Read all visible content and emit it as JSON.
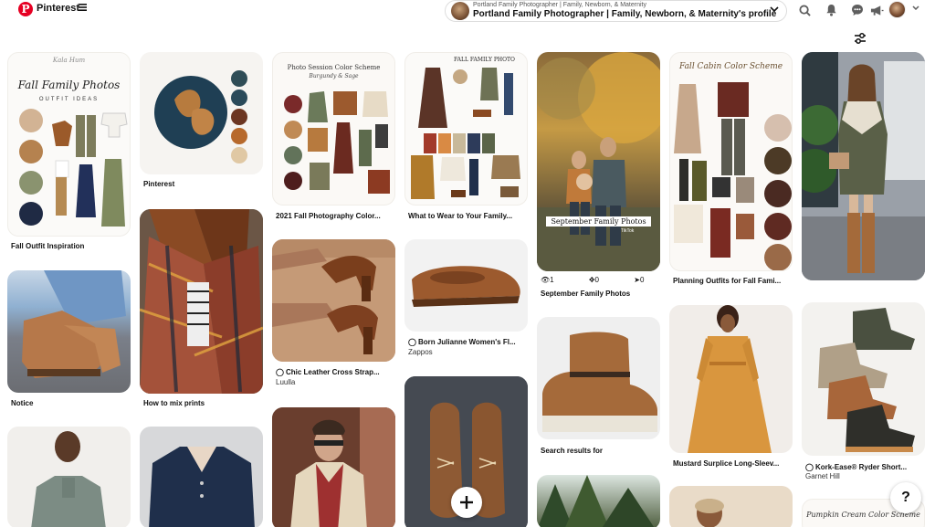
{
  "header": {
    "brand": "Pinterest",
    "profile_small": "Portland Family Photographer | Family, Newborn, & Maternity",
    "profile_main": "Portland Family Photographer | Family, Newborn, & Maternity's profile",
    "icons": [
      "search-icon",
      "bell-icon",
      "messages-icon",
      "megaphone-icon",
      "avatar",
      "chevron-down-icon"
    ],
    "accent": "#e60023"
  },
  "pins": {
    "c1p1": {
      "title": "Fall Outfit Inspiration",
      "img_script": "Kala Hum",
      "img_title": "Fall Family Photos",
      "img_sub": "OUTFIT IDEAS"
    },
    "c1p2": {
      "title": "Notice"
    },
    "c2p1": {
      "title": "Pinterest"
    },
    "c2p2": {
      "title": "How to mix prints"
    },
    "c3p1": {
      "title": "2021 Fall Photography Color...",
      "img_title": "Photo Session Color Scheme",
      "img_sub": "Burgundy & Sage"
    },
    "c3p2": {
      "title": "Chic Leather Cross Strap...",
      "sub": "Luulla"
    },
    "c4p1": {
      "title": "What to Wear to Your Family...",
      "img_title": "FALL FAMILY PHOTO"
    },
    "c4p2": {
      "title": "Born Julianne Women's Fl...",
      "sub": "Zappos"
    },
    "c5p1": {
      "title": "September Family Photos",
      "overlay": "September Family Photos",
      "overlay_small": "TikTok",
      "stats": [
        "1",
        "0",
        "0"
      ]
    },
    "c5p2": {
      "title": "Search results for"
    },
    "c6p1": {
      "title": "Planning Outfits for Fall Fami...",
      "img_title": "Fall Cabin Color Scheme"
    },
    "c6p2": {
      "title": "Mustard Surplice Long-Sleev..."
    },
    "c7p2": {
      "title": "Kork-Ease® Ryder Short...",
      "sub": "Garnet Hill"
    },
    "c7p3": {
      "img_title": "Pumpkin Cream Color Scheme"
    }
  },
  "fab": {
    "label": "+"
  },
  "help": {
    "label": "?"
  }
}
